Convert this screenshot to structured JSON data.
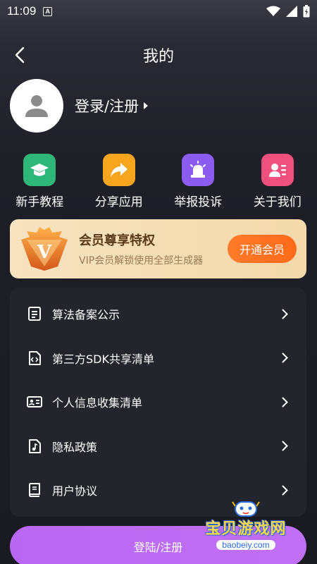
{
  "status_bar": {
    "time": "11:09",
    "notif_letter": "A"
  },
  "header": {
    "title": "我的"
  },
  "profile": {
    "login_label": "登录/注册"
  },
  "quick_actions": [
    {
      "label": "新手教程",
      "icon": "graduation-cap-icon",
      "color": "#2fb679"
    },
    {
      "label": "分享应用",
      "icon": "share-arrow-icon",
      "color": "#f7a51e"
    },
    {
      "label": "举报投诉",
      "icon": "alarm-light-icon",
      "color": "#8a5cf0"
    },
    {
      "label": "关于我们",
      "icon": "contact-card-icon",
      "color": "#f0507e"
    }
  ],
  "vip": {
    "badge_letter": "V",
    "title": "会员尊享特权",
    "subtitle": "VIP会员解锁使用全部生成器",
    "button_label": "开通会员"
  },
  "menu": [
    {
      "label": "算法备案公示",
      "icon": "document-list-icon"
    },
    {
      "label": "第三方SDK共享清单",
      "icon": "code-file-icon"
    },
    {
      "label": "个人信息收集清单",
      "icon": "id-card-icon"
    },
    {
      "label": "隐私政策",
      "icon": "music-file-icon"
    },
    {
      "label": "用户协议",
      "icon": "book-icon"
    }
  ],
  "bottom_button": {
    "label": "登陆/注册",
    "color": "#b867f2"
  },
  "watermark": {
    "title": "宝贝游戏网",
    "url": "baobeiy.com"
  }
}
